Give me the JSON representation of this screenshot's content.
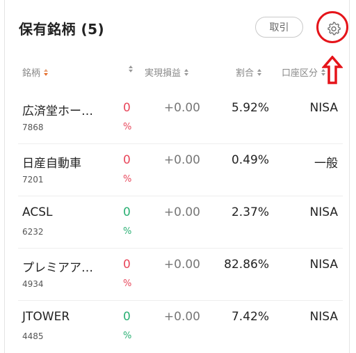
{
  "header": {
    "title": "保有銘柄 (5)",
    "trade_button": "取引",
    "settings_icon": "gear-icon"
  },
  "columns": [
    "銘柄",
    "実現損益",
    "割合",
    "口座区分"
  ],
  "rows": [
    {
      "name": "広済堂ホー…",
      "code": "7868",
      "change": "0",
      "change_unit": "%",
      "change_sign": "negative",
      "realized_pl": "+0.00",
      "ratio": "5.92%",
      "account": "NISA"
    },
    {
      "name": "日産自動車",
      "code": "7201",
      "change": "0",
      "change_unit": "%",
      "change_sign": "negative",
      "realized_pl": "+0.00",
      "ratio": "0.49%",
      "account": "一般"
    },
    {
      "name": "ACSL",
      "code": "6232",
      "change": "0",
      "change_unit": "%",
      "change_sign": "positive",
      "realized_pl": "+0.00",
      "ratio": "2.37%",
      "account": "NISA"
    },
    {
      "name": "プレミアア…",
      "code": "4934",
      "change": "0",
      "change_unit": "%",
      "change_sign": "negative",
      "realized_pl": "+0.00",
      "ratio": "82.86%",
      "account": "NISA"
    },
    {
      "name": "JTOWER",
      "code": "4485",
      "change": "0",
      "change_unit": "%",
      "change_sign": "positive",
      "realized_pl": "+0.00",
      "ratio": "7.42%",
      "account": "NISA"
    }
  ],
  "colors": {
    "negative": "#e8475b",
    "positive": "#2bb074",
    "annotation": "#e5141a",
    "sort_active": "#e56d2b"
  }
}
